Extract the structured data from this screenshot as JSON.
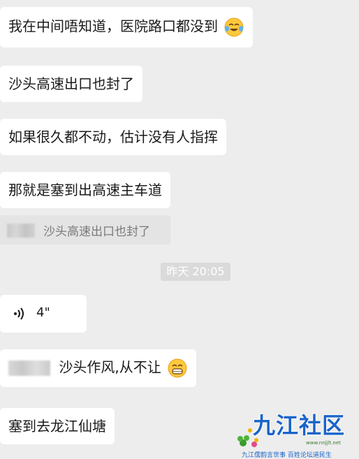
{
  "messages": [
    {
      "text": "我在中间唔知道，医院路口都没到",
      "emoji": "face-with-tears-icon"
    },
    {
      "text": "沙头高速出口也封了"
    },
    {
      "text": "如果很久都不动，估计没有人指挥"
    },
    {
      "text": "那就是塞到出高速主车道"
    }
  ],
  "quoted_reply": {
    "text": "沙头高速出口也封了"
  },
  "timestamp": "昨天 20:05",
  "voice_message": {
    "duration": "4\"",
    "icon": "voice-wave-icon"
  },
  "mention_message": {
    "text": "沙头作风,从不让",
    "emoji": "grinning-face-icon"
  },
  "last_message": {
    "text": "塞到去龙江仙塘"
  },
  "watermark": {
    "title": "九江社区",
    "url": "www.nnjjlt.net",
    "slogan": "九江儒韵言世事 百姓论坛道民生"
  },
  "colors": {
    "background": "#ededed",
    "bubble": "#ffffff",
    "quote_bg": "#e4e4e4",
    "timestamp_bg": "#dadada",
    "watermark_blue": "#1b64c8"
  }
}
